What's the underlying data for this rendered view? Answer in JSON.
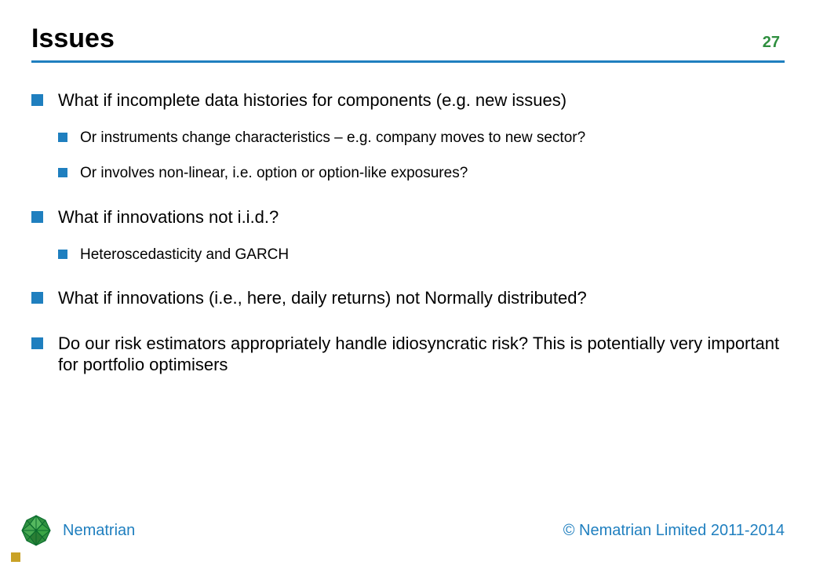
{
  "header": {
    "title": "Issues",
    "page_number": "27"
  },
  "bullets": [
    {
      "text": "What if incomplete data histories for components (e.g. new issues)",
      "children": [
        {
          "text": "Or instruments change characteristics – e.g. company moves to new sector?"
        },
        {
          "text": "Or involves non-linear, i.e. option or option-like exposures?"
        }
      ]
    },
    {
      "text": "What if innovations not i.i.d.?",
      "children": [
        {
          "text": "Heteroscedasticity and GARCH"
        }
      ]
    },
    {
      "text": "What if innovations (i.e., here, daily returns) not Normally distributed?",
      "children": []
    },
    {
      "text": "Do our risk estimators appropriately handle idiosyncratic risk? This is potentially very important for portfolio optimisers",
      "children": []
    }
  ],
  "footer": {
    "brand": "Nematrian",
    "copyright": "© Nematrian Limited 2011-2014"
  },
  "colors": {
    "rule": "#1f7fbf",
    "bullet": "#1f7fbf",
    "pagenum": "#2f8f3f",
    "brand": "#1f7fbf",
    "corner_square": "#c9a227"
  }
}
